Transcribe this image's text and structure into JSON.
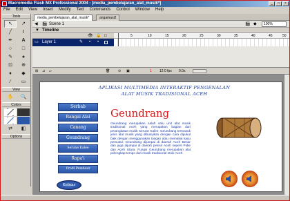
{
  "window": {
    "title": "Macromedia Flash MX Professional 2004 - [media_pembelajaran_alat_musik*]"
  },
  "menu": [
    "File",
    "Edit",
    "View",
    "Insert",
    "Modify",
    "Text",
    "Commands",
    "Control",
    "Window",
    "Help"
  ],
  "tools": {
    "label": "Tools",
    "view_label": "View",
    "colors_label": "Colors",
    "options_label": "Options"
  },
  "document": {
    "tabs": [
      "media_pembelajaran_alat_musik*",
      "angamasi2"
    ],
    "scene": "Scene 1",
    "zoom": "100%"
  },
  "timeline": {
    "title": "Timeline",
    "layer": "Layer 1",
    "ruler": [
      "5",
      "10",
      "15",
      "20",
      "25",
      "30",
      "35",
      "40",
      "45",
      "50"
    ],
    "frame": "1",
    "fps": "12.0 fps",
    "time": "0.0s"
  },
  "stage": {
    "heading1": "APLIKASI MULTIMEDIA INTERAKTIF PENGENALAN",
    "heading2": "ALAT MUSIK TRADISIONAL ACEH",
    "menu": [
      "Serbab",
      "Rangai Alai",
      "Canang",
      "Geundrang",
      "Serune Kalee",
      "Rapa'i",
      "Profil Pembuat"
    ],
    "content_title": "Geundrang",
    "content_text": "Geundrang merupakan salah satu unit alat musik tradisional Aceh yang merupakan bagian dari perangkatan musik Serune Kalee. Geundrang termasuk jenis alat musik yang dibunyikan dengan cara dipukul baik dengan menggunakan tangan atau memakai kayu pemukul. Geundrang dijumpai di daerah Aceh Besar dan juga dijumpai di daerah pesisir Aceh seperti Pidie dan Aceh Utara. Fungsi Geundrang merupakan alat pelengkap tempo dari musik tradisional etnik Aceh.",
    "exit_button": "Keluar"
  },
  "colors": {
    "accent": "#0a246a",
    "title_red": "#e01818",
    "menu_blue": "#2a57a8",
    "text_blue": "#1a3aa8"
  }
}
